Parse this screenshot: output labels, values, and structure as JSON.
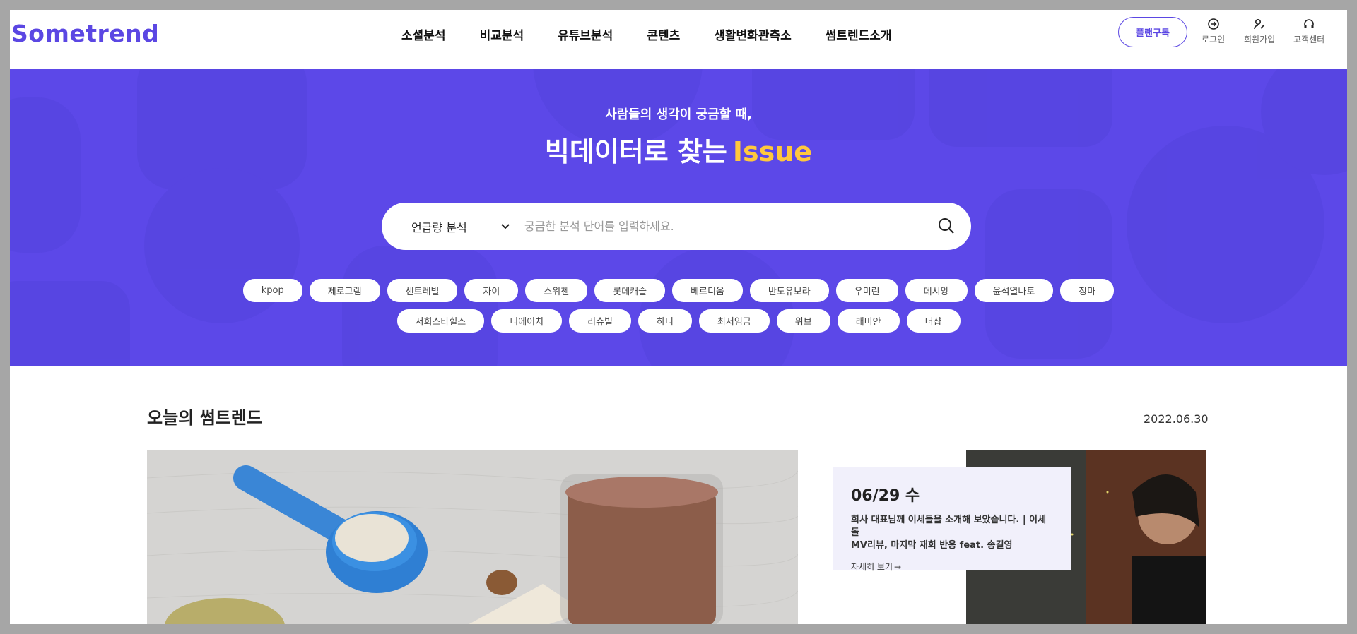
{
  "brand": {
    "logo": "Sometrend",
    "accent": "#5b47e3",
    "hero_bg": "#5c48e8",
    "highlight": "#ffc83d"
  },
  "nav": [
    {
      "label": "소셜분석"
    },
    {
      "label": "비교분석"
    },
    {
      "label": "유튜브분석"
    },
    {
      "label": "콘텐츠"
    },
    {
      "label": "생활변화관측소"
    },
    {
      "label": "썸트렌드소개"
    }
  ],
  "header": {
    "plan_button": "플랜구독",
    "login": {
      "label": "로그인",
      "icon": "login-icon"
    },
    "signup": {
      "label": "회원가입",
      "icon": "signup-icon"
    },
    "support": {
      "label": "고객센터",
      "icon": "headset-icon"
    }
  },
  "hero": {
    "subtitle": "사람들의 생각이 궁금할 때,",
    "title": "빅데이터로 찾는",
    "title_highlight": "Issue"
  },
  "search": {
    "select_value": "언급량 분석",
    "placeholder": "궁금한 분석 단어를 입력하세요.",
    "value": ""
  },
  "tags": [
    "kpop",
    "제로그램",
    "센트레빌",
    "자이",
    "스위첸",
    "롯데캐슬",
    "베르디움",
    "반도유보라",
    "우미린",
    "데시앙",
    "윤석열나토",
    "장마",
    "서희스타힐스",
    "디에이치",
    "리슈빌",
    "하니",
    "최저임금",
    "위브",
    "래미안",
    "더샵"
  ],
  "today": {
    "title": "오늘의 썸트렌드",
    "date": "2022.06.30",
    "card": {
      "date": "06/29 수",
      "desc_line1": "회사 대표님께 이세돌을 소개해 보았습니다. | 이세돌",
      "desc_line2": "MV리뷰, 마지막 재회 반응 feat. 송길영",
      "link": "자세히 보기"
    }
  }
}
